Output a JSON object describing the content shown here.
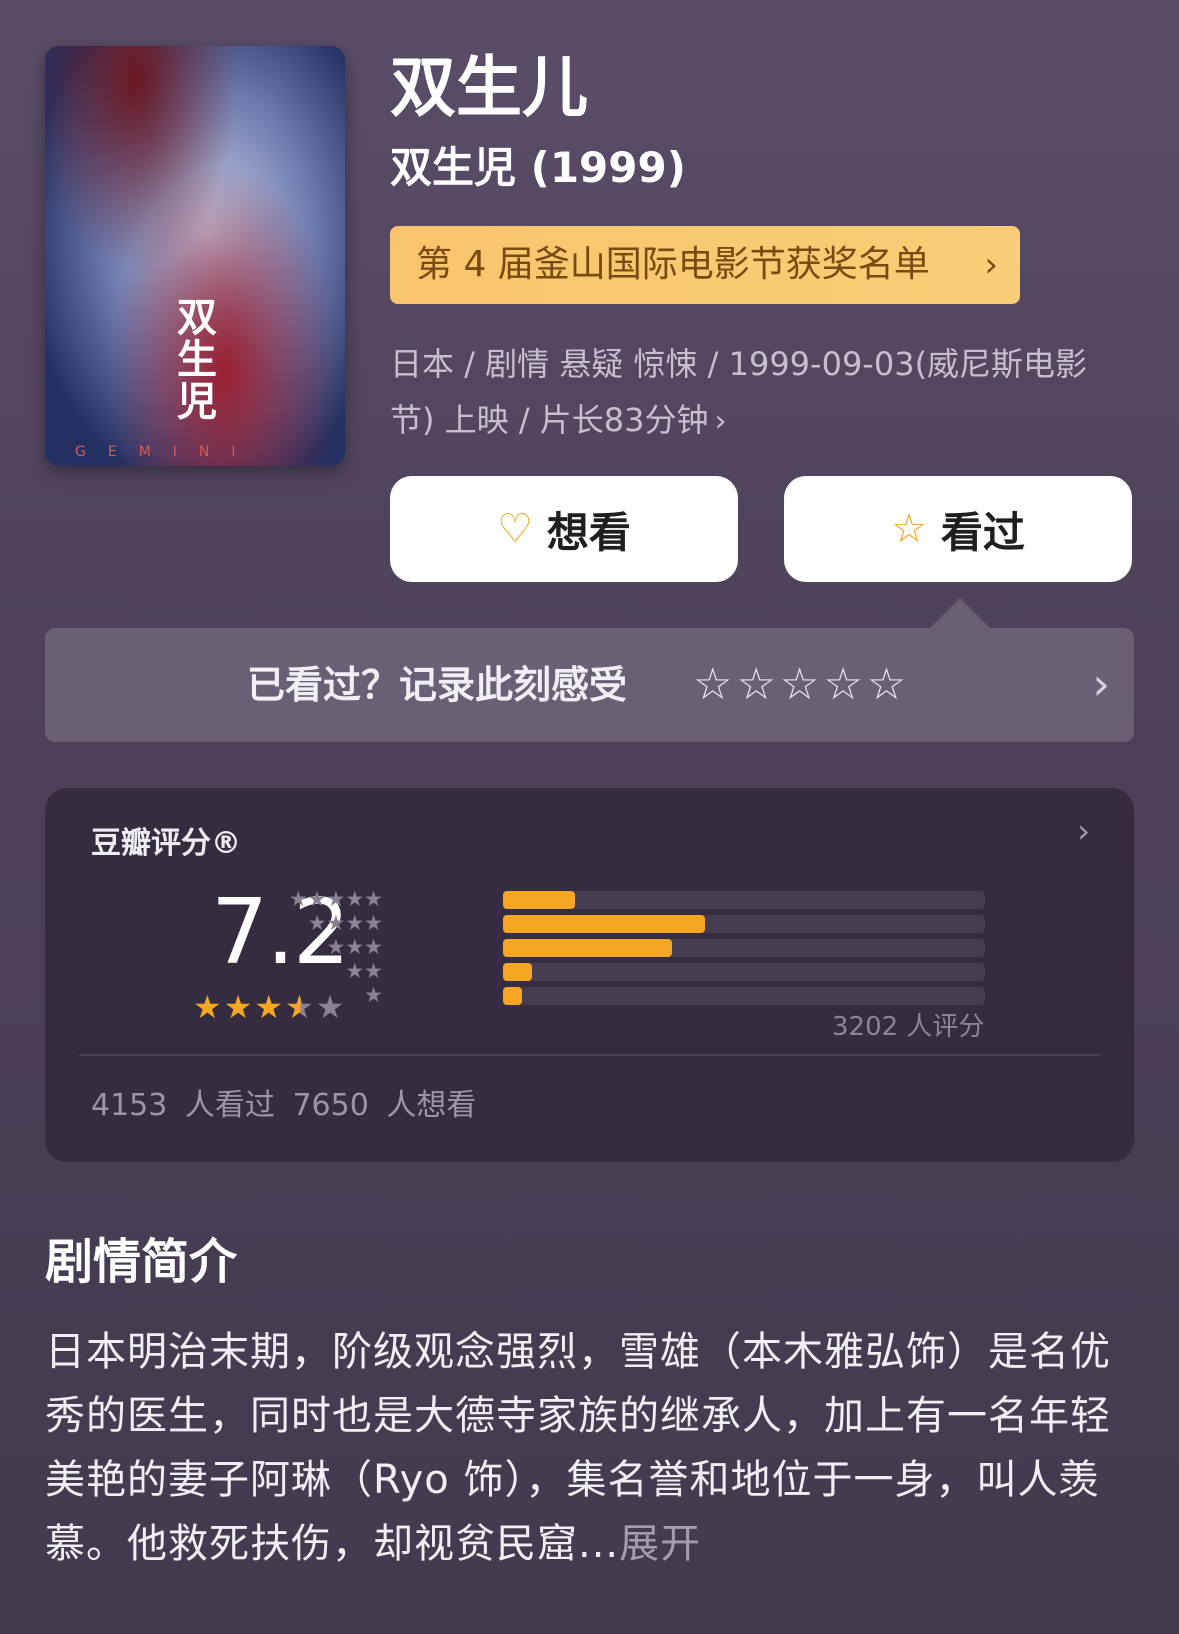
{
  "movie": {
    "title": "双生儿",
    "original_title": "双生児 (1999)",
    "poster_text": "双生児",
    "poster_subtext": "GEMINI",
    "award": "第 4 届釜山国际电影节获奖名单",
    "meta": "日本 / 剧情 悬疑 惊悚 / 1999-09-03(威尼斯电影节) 上映 / 片长83分钟"
  },
  "actions": {
    "want_label": "想看",
    "seen_label": "看过",
    "want_icon": "heart-plus-icon",
    "seen_icon": "star-icon"
  },
  "rate_prompt": {
    "text": "已看过？记录此刻感受",
    "stars": "☆☆☆☆☆"
  },
  "rating": {
    "label": "豆瓣评分®",
    "score": "7.2",
    "stars_filled": 3.5,
    "distribution": [
      {
        "stars": "★★★★★",
        "fraction": 0.15
      },
      {
        "stars": "★★★★",
        "fraction": 0.42
      },
      {
        "stars": "★★★",
        "fraction": 0.35
      },
      {
        "stars": "★★",
        "fraction": 0.06
      },
      {
        "stars": "★",
        "fraction": 0.04
      }
    ],
    "raters": "3202 人评分",
    "watched": "4153 人看过",
    "wishes": "7650 人想看"
  },
  "synopsis": {
    "heading": "剧情简介",
    "text": "日本明治末期，阶级观念强烈，雪雄（本木雅弘饰）是名优秀的医生，同时也是大德寺家族的继承人，加上有一名年轻美艳的妻子阿琳（Ryo 饰），集名誉和地位于一身，叫人羡慕。他救死扶伤，却视贫民窟...",
    "more": "展开"
  },
  "colors": {
    "accent": "#f5a623",
    "award_bg": "#f7c56b",
    "card_bg": "#352d3f"
  }
}
